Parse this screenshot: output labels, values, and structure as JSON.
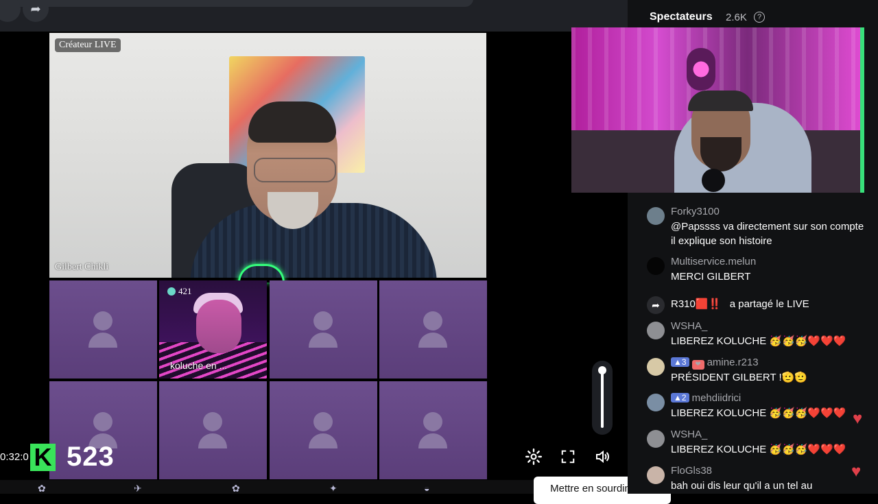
{
  "main_video": {
    "creator_label": "Créateur LIVE",
    "guest_name": "Gilbert Chikli"
  },
  "guest_tile": {
    "badge_count": "421",
    "label": "koluche en ..."
  },
  "counter": {
    "time": "0:32:0",
    "logo_letter": "K",
    "value": "523"
  },
  "controls": {
    "mute_tooltip": "Mettre en sourdine (M)"
  },
  "panel": {
    "spectators_label": "Spectateurs",
    "spectators_count": "2.6K",
    "help_glyph": "?"
  },
  "chat": [
    {
      "user": "Forky3100",
      "text": "@Papssss va directement sur son compte il explique son histoire"
    },
    {
      "user": "Multiservice.melun",
      "text": "MERCI GILBERT"
    },
    {
      "user": "WSHA_",
      "text": "LIBEREZ KOLUCHE 🥳🥳🥳❤️❤️❤️"
    },
    {
      "user": "amine.r213",
      "level": "3",
      "text": "PRÉSIDENT GILBERT !🫡🫡"
    },
    {
      "user": "mehdiidrici",
      "level": "2",
      "text": "LIBEREZ KOLUCHE 🥳🥳🥳❤️❤️❤️"
    },
    {
      "user": "WSHA_",
      "text": "LIBEREZ KOLUCHE 🥳🥳🥳❤️❤️❤️"
    },
    {
      "user": "FloGls38",
      "text": "bah oui dis leur qu'il a un tel au"
    }
  ],
  "share": {
    "user": "R310",
    "user_suffix": "🟥‼️",
    "text": "a partagé le LIVE"
  },
  "colors": {
    "accent_green": "#39e35a",
    "level_badge": "#5b78d6",
    "tile_purple": "#6c4e8d"
  }
}
